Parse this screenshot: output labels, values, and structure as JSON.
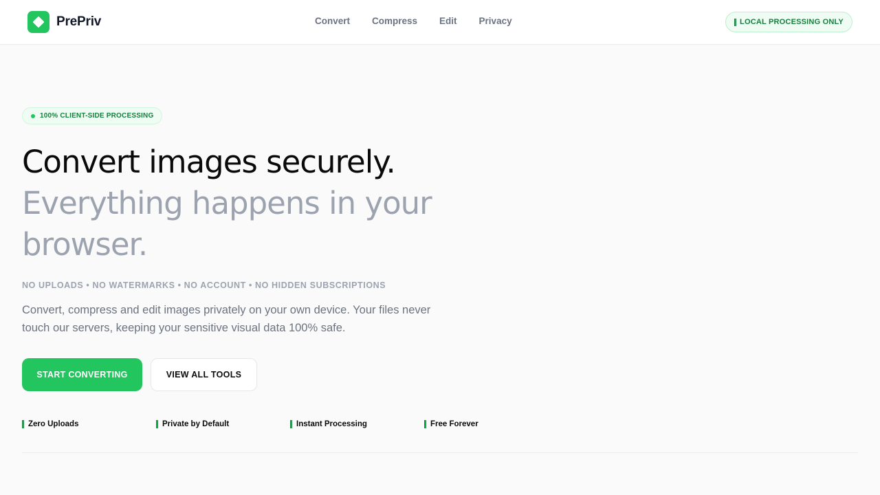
{
  "brand": {
    "name": "PrePriv",
    "icon": "diamond-logo-icon",
    "accent": "#22c55e"
  },
  "nav": {
    "items": [
      "Convert",
      "Compress",
      "Edit",
      "Privacy"
    ]
  },
  "header_badge": {
    "label": "LOCAL PROCESSING ONLY",
    "icon": "check-bar-icon"
  },
  "hero": {
    "pill": "100% CLIENT-SIDE PROCESSING",
    "headline_line1": "Convert images securely.",
    "headline_line2": "Everything happens in your",
    "headline_line3": "browser.",
    "tagline": "NO UPLOADS • NO WATERMARKS • NO ACCOUNT • NO HIDDEN SUBSCRIPTIONS",
    "description": "Convert, compress and edit images privately on your own device. Your files never touch our servers, keeping your sensitive visual data 100% safe.",
    "primary_button": "START CONVERTING",
    "secondary_button": "VIEW ALL TOOLS"
  },
  "features": [
    "Zero Uploads",
    "Private by Default",
    "Instant Processing",
    "Free Forever"
  ],
  "colors": {
    "primary": "#22c55e",
    "primary_dark": "#15803d",
    "muted": "#9ca3af",
    "text": "#0a0a0a"
  }
}
